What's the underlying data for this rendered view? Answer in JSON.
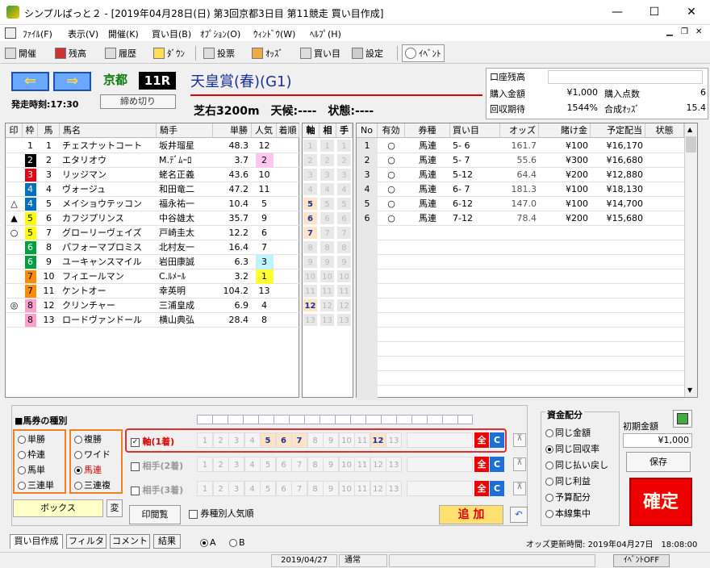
{
  "window": {
    "title": "シンプルぱっと２ - [2019年04月28日(日) 第3回京都3日目 第11競走 買い目作成]",
    "minimize": "—",
    "maximize": "☐",
    "close": "✕"
  },
  "menu": [
    "ﾌｧｲﾙ(F)",
    "表示(V)",
    "開催(K)",
    "買い目(B)",
    "ｵﾌﾟｼｮﾝ(O)",
    "ｳｨﾝﾄﾞｳ(W)",
    "ﾍﾙﾌﾟ(H)"
  ],
  "toolbar": [
    "開催",
    "残高",
    "履歴",
    "ﾀﾞｳﾝ",
    "投票",
    "ｵｯｽﾞ",
    "買い目",
    "設定",
    "ｲﾍﾞﾝﾄ"
  ],
  "race": {
    "venue": "京都",
    "number": "11R",
    "name": "天皇賞(春)(G1)",
    "start_time": "発走時刻:17:30",
    "close_label": "締め切り",
    "conditions": "芝右3200m　天候:----　状態:----"
  },
  "summary": {
    "balance_label": "口座残高",
    "amount_label": "購入金額",
    "amount": "¥1,000",
    "points_label": "購入点数",
    "points": "6",
    "rate_label": "回収期待",
    "rate": "1544%",
    "odds_label": "合成ｵｯｽﾞ",
    "odds": "15.4"
  },
  "horse_headers": [
    "印",
    "枠",
    "馬",
    "馬名",
    "騎手",
    "単勝",
    "人気",
    "着順"
  ],
  "horses": [
    {
      "mark": "",
      "waku": "1",
      "num": "1",
      "name": "チェスナットコート",
      "jockey": "坂井瑠星",
      "odds": "48.3",
      "pop": "12"
    },
    {
      "mark": "",
      "waku": "2",
      "num": "2",
      "name": "エタリオウ",
      "jockey": "M.ﾃﾞﾑｰﾛ",
      "odds": "3.7",
      "pop": "2"
    },
    {
      "mark": "",
      "waku": "3",
      "num": "3",
      "name": "リッジマン",
      "jockey": "蛯名正義",
      "odds": "43.6",
      "pop": "10"
    },
    {
      "mark": "",
      "waku": "4",
      "num": "4",
      "name": "ヴォージュ",
      "jockey": "和田竜二",
      "odds": "47.2",
      "pop": "11"
    },
    {
      "mark": "△",
      "waku": "4",
      "num": "5",
      "name": "メイショウテッコン",
      "jockey": "福永祐一",
      "odds": "10.4",
      "pop": "5"
    },
    {
      "mark": "▲",
      "waku": "5",
      "num": "6",
      "name": "カフジプリンス",
      "jockey": "中谷雄太",
      "odds": "35.7",
      "pop": "9"
    },
    {
      "mark": "○",
      "waku": "5",
      "num": "7",
      "name": "グローリーヴェイズ",
      "jockey": "戸崎圭太",
      "odds": "12.2",
      "pop": "6"
    },
    {
      "mark": "",
      "waku": "6",
      "num": "8",
      "name": "パフォーマプロミス",
      "jockey": "北村友一",
      "odds": "16.4",
      "pop": "7"
    },
    {
      "mark": "",
      "waku": "6",
      "num": "9",
      "name": "ユーキャンスマイル",
      "jockey": "岩田康誠",
      "odds": "6.3",
      "pop": "3"
    },
    {
      "mark": "",
      "waku": "7",
      "num": "10",
      "name": "フィエールマン",
      "jockey": "C.ﾙﾒｰﾙ",
      "odds": "3.2",
      "pop": "1"
    },
    {
      "mark": "",
      "waku": "7",
      "num": "11",
      "name": "ケントオー",
      "jockey": "幸英明",
      "odds": "104.2",
      "pop": "13"
    },
    {
      "mark": "◎",
      "waku": "8",
      "num": "12",
      "name": "クリンチャー",
      "jockey": "三浦皇成",
      "odds": "6.9",
      "pop": "4"
    },
    {
      "mark": "",
      "waku": "8",
      "num": "13",
      "name": "ロードヴァンドール",
      "jockey": "横山典弘",
      "odds": "28.4",
      "pop": "8"
    }
  ],
  "axis_headers": [
    "軸",
    "相",
    "手"
  ],
  "axis_selected": [
    "5",
    "6",
    "7",
    "12"
  ],
  "bet_headers": [
    "No",
    "有効",
    "券種",
    "買い目",
    "オッズ",
    "賭け金",
    "予定配当",
    "状態"
  ],
  "bets": [
    {
      "no": "1",
      "valid": "○",
      "type": "馬連",
      "combo": "5- 6",
      "odds": "161.7",
      "stake": "¥100",
      "payout": "¥16,170"
    },
    {
      "no": "2",
      "valid": "○",
      "type": "馬連",
      "combo": "5- 7",
      "odds": "55.6",
      "stake": "¥300",
      "payout": "¥16,680"
    },
    {
      "no": "3",
      "valid": "○",
      "type": "馬連",
      "combo": "5-12",
      "odds": "64.4",
      "stake": "¥200",
      "payout": "¥12,880"
    },
    {
      "no": "4",
      "valid": "○",
      "type": "馬連",
      "combo": "6- 7",
      "odds": "181.3",
      "stake": "¥100",
      "payout": "¥18,130"
    },
    {
      "no": "5",
      "valid": "○",
      "type": "馬連",
      "combo": "6-12",
      "odds": "147.0",
      "stake": "¥100",
      "payout": "¥14,700"
    },
    {
      "no": "6",
      "valid": "○",
      "type": "馬連",
      "combo": "7-12",
      "odds": "78.4",
      "stake": "¥200",
      "payout": "¥15,680"
    }
  ],
  "bet_type": {
    "title": "■馬券の種別",
    "left": [
      "単勝",
      "枠連",
      "馬単",
      "三連単"
    ],
    "right": [
      "複勝",
      "ワイド",
      "馬連",
      "三連複"
    ],
    "selected": "馬連",
    "method": "ボックス",
    "change": "変",
    "print": "印閲覧",
    "sort_label": "券種別人気順"
  },
  "selectors": [
    {
      "label": "軸(1着)",
      "checked": true
    },
    {
      "label": "相手(2着)",
      "checked": false
    },
    {
      "label": "相手(3着)",
      "checked": false
    }
  ],
  "all_label": "全",
  "c_label": "C",
  "add_label": "追 加",
  "fund": {
    "title": "資金配分",
    "options": [
      "同じ金額",
      "同じ回収率",
      "同じ払い戻し",
      "同じ利益",
      "予算配分",
      "本線集中"
    ],
    "selected": "同じ回収率",
    "initial_label": "初期金額",
    "initial": "¥1,000",
    "save": "保存",
    "confirm": "確定"
  },
  "tabs": [
    "買い目作成",
    "フィルタ",
    "コメント",
    "結果"
  ],
  "ab": [
    "A",
    "B"
  ],
  "odds_updated": "オッズ更新時間: 2019年04月27日　18:08:00",
  "status": {
    "date": "2019/04/27",
    "mode": "通常",
    "event": "ｲﾍﾞﾝﾄOFF"
  },
  "colors": {
    "waku1": "#ffffff",
    "waku2": "#000000",
    "waku3": "#e60012",
    "waku4": "#0070c0",
    "waku5": "#ffff00",
    "waku6": "#00a040",
    "waku7": "#ff8c00",
    "waku8": "#ff9fd0"
  }
}
